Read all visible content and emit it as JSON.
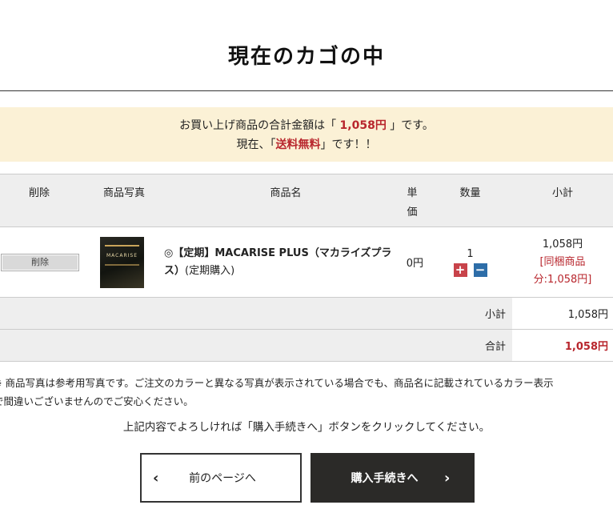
{
  "page": {
    "title": "現在のカゴの中"
  },
  "notice": {
    "line1_prefix": "お買い上げ商品の合計金額は「 ",
    "line1_amount": "1,058円",
    "line1_suffix": " 」です。",
    "line2_prefix": "現在、「",
    "line2_highlight": "送料無料",
    "line2_suffix": "」です！！"
  },
  "table": {
    "headers": {
      "delete": "削除",
      "photo": "商品写真",
      "name": "商品名",
      "unit_price": "単価",
      "quantity": "数量",
      "subtotal": "小計"
    },
    "item": {
      "delete_label": "削除",
      "name_prefix": "◎【定期】MACARISE PLUS（マカライズプラス）",
      "name_suffix": "(定期購入)",
      "thumb_text": "MACARISE",
      "unit_price": "0円",
      "quantity": "1",
      "plus": "+",
      "minus": "−",
      "subtotal": "1,058円",
      "bundle_note": "[同梱商品分:1,058円]"
    },
    "summary": [
      {
        "label": "小計",
        "value": "1,058円"
      },
      {
        "label": "合計",
        "value": "1,058円"
      }
    ]
  },
  "note": "※ 商品写真は参考用写真です。ご注文のカラーと異なる写真が表示されている場合でも、商品名に記載されているカラー表示で間違いございませんのでご安心ください。",
  "note_line1": "※ 商品写真は参考用写真です。ご注文のカラーと異なる写真が表示されている場合でも、商品名に記載されているカラー表示",
  "note_line2": "で間違いございませんのでご安心ください。",
  "instruction": "上記内容でよろしければ「購入手続きへ」ボタンをクリックしてください。",
  "buttons": {
    "prev_label": "前のページへ",
    "prev_icon": "‹",
    "next_label": "購入手続きへ",
    "next_icon": "›"
  },
  "colors": {
    "accent_red": "#b8262d",
    "notice_bg": "#fbf1d6",
    "next_button_bg": "#2b2a28",
    "plus_btn": "#c8434a",
    "minus_btn": "#2d6da8"
  }
}
